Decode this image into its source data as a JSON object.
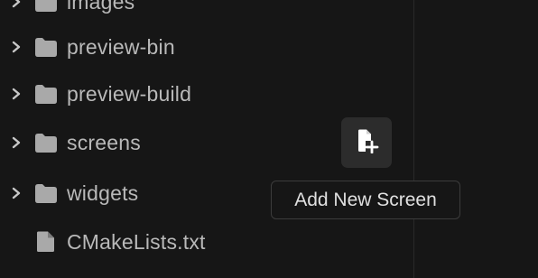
{
  "explorer": {
    "items": [
      {
        "type": "folder",
        "label": "images",
        "expandable": true
      },
      {
        "type": "folder",
        "label": "preview-bin",
        "expandable": true
      },
      {
        "type": "folder",
        "label": "preview-build",
        "expandable": true
      },
      {
        "type": "folder",
        "label": "screens",
        "expandable": true
      },
      {
        "type": "folder",
        "label": "widgets",
        "expandable": true
      },
      {
        "type": "file",
        "label": "CMakeLists.txt",
        "expandable": false
      }
    ]
  },
  "toolbar": {
    "add_screen_icon": "file-plus-icon",
    "add_screen_tooltip": "Add New Screen"
  },
  "colors": {
    "background": "#161616",
    "text": "#b9b9b9",
    "icon": "#a9a9a9",
    "button_bg": "#2c2c2c",
    "tooltip_border": "#3c3c3c"
  }
}
